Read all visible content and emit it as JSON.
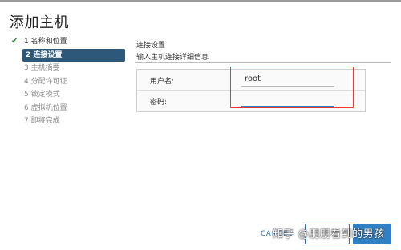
{
  "dialog": {
    "title": "添加主机"
  },
  "steps": [
    {
      "label": "1 名称和位置",
      "state": "done"
    },
    {
      "label": "2 连接设置",
      "state": "active"
    },
    {
      "label": "3 主机摘要",
      "state": "pending"
    },
    {
      "label": "4 分配许可证",
      "state": "pending"
    },
    {
      "label": "5 锁定模式",
      "state": "pending"
    },
    {
      "label": "6 虚拟机位置",
      "state": "pending"
    },
    {
      "label": "7 即将完成",
      "state": "pending"
    }
  ],
  "main": {
    "title": "连接设置",
    "subtitle": "输入主机连接详细信息",
    "username_label": "用户名:",
    "username_value": "root",
    "password_label": "密码:",
    "password_value": ""
  },
  "footer": {
    "cancel_label": "CANCEL"
  },
  "watermark": "知乎 @朋朋看到的男孩",
  "colors": {
    "active_step": "#2d5879",
    "accent": "#2f80c4",
    "highlight": "#e53935",
    "check": "#2e8b3a"
  },
  "icons": {
    "done_step": "check-icon"
  }
}
